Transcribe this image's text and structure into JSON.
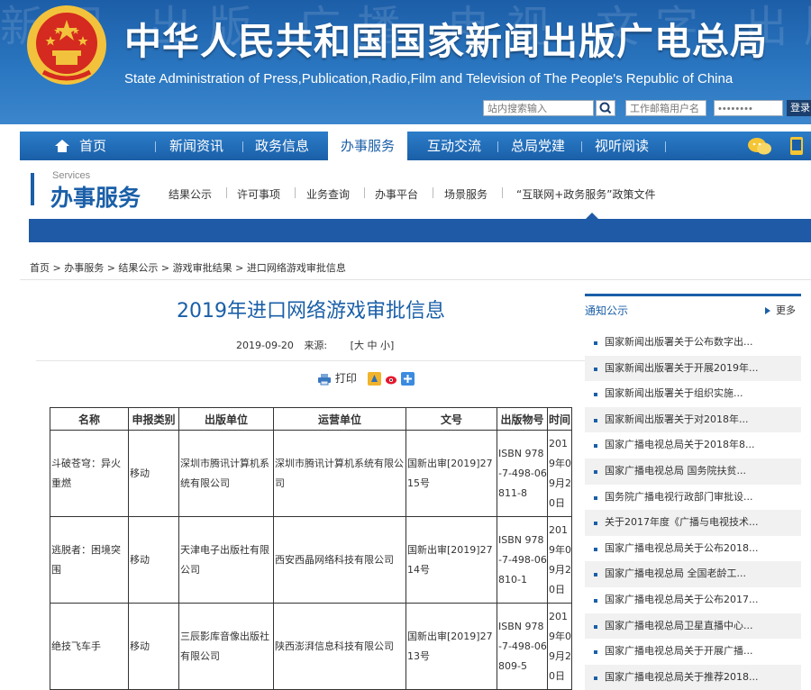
{
  "header": {
    "title": "中华人民共和国国家新闻出版广电总局",
    "subtitle": "State Administration of Press,Publication,Radio,Film and Television of The People's Republic of China",
    "background_text": "新闻 出版 广播 电视 文字 出版",
    "search_placeholder": "站内搜索输入",
    "email_placeholder": "工作邮箱用户名",
    "password_placeholder": "••••••••",
    "login_label": "登录"
  },
  "nav": {
    "items": [
      "首页",
      "新闻资讯",
      "政务信息",
      "办事服务",
      "互动交流",
      "总局党建",
      "视听阅读"
    ],
    "active": "办事服务"
  },
  "services": {
    "english": "Services",
    "title": "办事服务",
    "items": [
      "结果公示",
      "许可事项",
      "业务查询",
      "办事平台",
      "场景服务",
      "“互联网+政务服务”政策文件"
    ]
  },
  "breadcrumb": "首页 > 办事服务 > 结果公示 > 游戏审批结果 > 进口网络游戏审批信息",
  "article": {
    "title": "2019年进口网络游戏审批信息",
    "date": "2019-09-20",
    "source_label": "来源:",
    "font_size_controls": "[大 中 小]",
    "print_label": "打印"
  },
  "table": {
    "headers": [
      "名称",
      "申报类别",
      "出版单位",
      "运营单位",
      "文号",
      "出版物号",
      "时间"
    ],
    "rows": [
      {
        "name": "斗破苍穹：异火重燃",
        "category": "移动",
        "publisher": "深圳市腾讯计算机系统有限公司",
        "operator": "深圳市腾讯计算机系统有限公司",
        "doc_no": "国新出审[2019]2715号",
        "isbn": "ISBN 978-7-498-06811-8",
        "time": "2019年09月20日"
      },
      {
        "name": "逃脱者：困境突围",
        "category": "移动",
        "publisher": "天津电子出版社有限公司",
        "operator": "西安西晶网络科技有限公司",
        "doc_no": "国新出审[2019]2714号",
        "isbn": "ISBN 978-7-498-06810-1",
        "time": "2019年09月20日"
      },
      {
        "name": "绝技飞车手",
        "category": "移动",
        "publisher": "三辰影库音像出版社有限公司",
        "operator": "陕西澎湃信息科技有限公司",
        "doc_no": "国新出审[2019]2713号",
        "isbn": "ISBN 978-7-498-06809-5",
        "time": "2019年09月20日"
      }
    ]
  },
  "notice": {
    "heading": "通知公示",
    "more_label": "更多",
    "items": [
      "国家新闻出版署关于公布数字出...",
      "国家新闻出版署关于开展2019年...",
      "国家新闻出版署关于组织实施...",
      "国家新闻出版署关于对2018年...",
      "国家广播电视总局关于2018年8...",
      "国家广播电视总局 国务院扶贫...",
      "国务院广播电视行政部门审批设...",
      "关于2017年度《广播与电视技术...",
      "国家广播电视总局关于公布2018...",
      "国家广播电视总局 全国老龄工...",
      "国家广播电视总局关于公布2017...",
      "国家广播电视总局卫星直播中心...",
      "国家广播电视总局关于开展广播...",
      "国家广播电视总局关于推荐2018..."
    ]
  },
  "colors": {
    "brand_blue": "#1a5fa8",
    "emblem_red": "#d42a1f",
    "emblem_gold": "#f2c23c"
  }
}
